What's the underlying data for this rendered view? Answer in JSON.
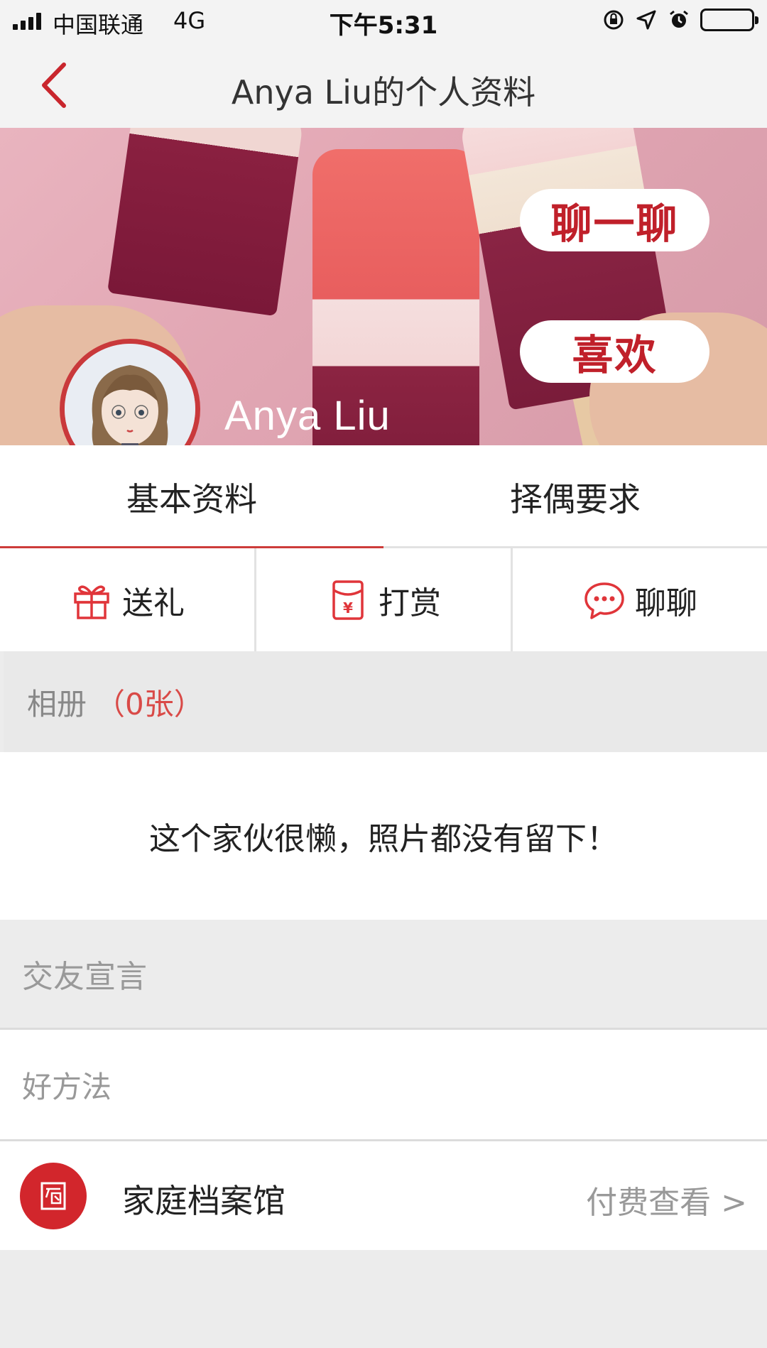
{
  "status_bar": {
    "carrier": "中国联通",
    "network": "4G",
    "time": "下午5:31"
  },
  "nav": {
    "title": "Anya Liu的个人资料"
  },
  "profile": {
    "name": "Anya Liu",
    "chat_button": "聊一聊",
    "like_button": "喜欢"
  },
  "tabs": [
    {
      "label": "基本资料",
      "active": true
    },
    {
      "label": "择偶要求",
      "active": false
    }
  ],
  "actions": [
    {
      "label": "送礼",
      "icon": "gift-icon"
    },
    {
      "label": "打赏",
      "icon": "red-envelope-icon"
    },
    {
      "label": "聊聊",
      "icon": "chat-bubble-icon"
    }
  ],
  "album": {
    "label": "相册",
    "count": "（0张）",
    "empty_text": "这个家伙很懒，照片都没有留下！"
  },
  "manifesto": {
    "label": "交友宣言",
    "text": "好方法"
  },
  "archive": {
    "title": "家庭档案馆",
    "action": "付费查看 >"
  },
  "colors": {
    "accent": "#cd3c3a",
    "brand_red": "#d2262c",
    "background": "#ececec"
  }
}
